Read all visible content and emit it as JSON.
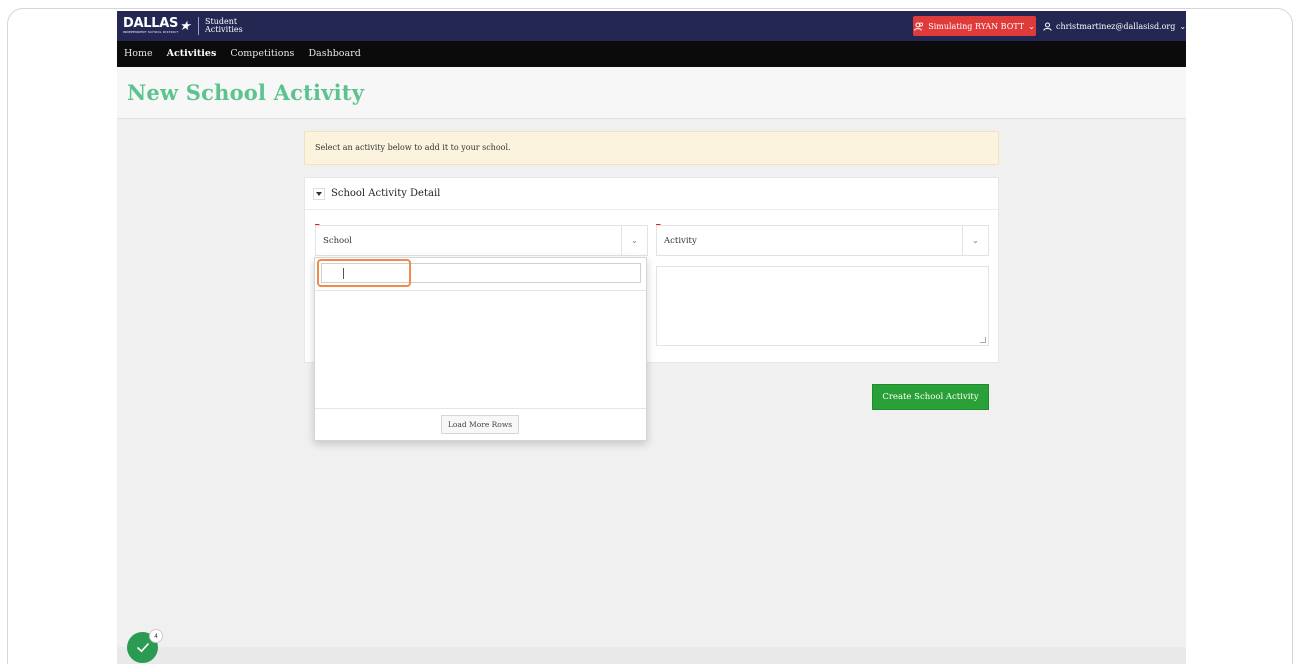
{
  "app": {
    "logo_text": "DALLAS",
    "logo_subtext": "INDEPENDENT SCHOOL DISTRICT",
    "app_name_line1": "Student",
    "app_name_line2": "Activities"
  },
  "header": {
    "simulating_label": "Simulating RYAN BOTT",
    "user_email": "christmartinez@dallasisd.org"
  },
  "nav": {
    "items": [
      {
        "label": "Home",
        "active": false
      },
      {
        "label": "Activities",
        "active": true
      },
      {
        "label": "Competitions",
        "active": false
      },
      {
        "label": "Dashboard",
        "active": false
      }
    ]
  },
  "page": {
    "title": "New School Activity",
    "alert": "Select an activity below to add it to your school."
  },
  "panel": {
    "title": "School Activity Detail",
    "school_placeholder": "School",
    "activity_placeholder": "Activity",
    "create_label": "Create School Activity"
  },
  "dropdown": {
    "search_value": "",
    "load_more_label": "Load More Rows"
  },
  "widget": {
    "badge_count": "4"
  },
  "colors": {
    "topbar": "#242752",
    "title_green": "#5cc38f",
    "simulate_red": "#e03b3b",
    "create_green": "#2aa039",
    "focus_orange": "#f08a4b"
  }
}
